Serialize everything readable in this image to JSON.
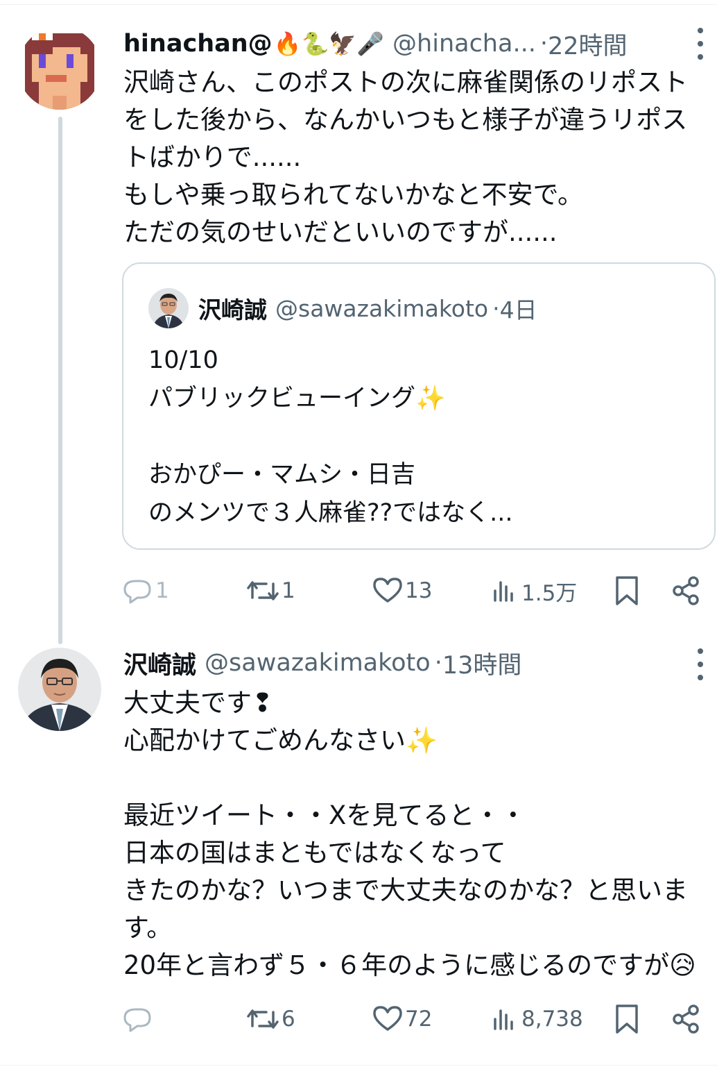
{
  "colors": {
    "text": "#0f1419",
    "muted": "#536471",
    "border": "#cfd9de"
  },
  "tweet1": {
    "name": "hinachan@",
    "emojis": "🔥🐍🦅🎤",
    "handle": "@hinacha...",
    "time": "22時間",
    "body": "沢崎さん、このポストの次に麻雀関係のリポスト\nをした後から、なんかいつもと様子が違うリポス\nトばかりで......\nもしや乗っ取られてないかなと不安で。\nただの気のせいだといいのですが......",
    "quote": {
      "name": "沢崎誠",
      "handle": "@sawazakimakoto",
      "time": "4日",
      "body": "10/10\nパブリックビューイング✨\n\nおかぴー・マムシ・日吉\nのメンツで３人麻雀??ではなく..."
    },
    "actions": {
      "reply_icon": "reply-icon",
      "reply": "1",
      "repost": "1",
      "like": "13",
      "views": "1.5万"
    }
  },
  "tweet2": {
    "name": "沢崎誠",
    "handle": "@sawazakimakoto",
    "time": "13時間",
    "body": "大丈夫です❢\n心配かけてごめんなさい✨\n\n最近ツイート・・Xを見てると・・\n日本の国はまともではなくなって\nきたのかな？いつまで大丈夫なのかな？と思いま\nす。\n20年と言わず５・６年のように感じるのですが😥",
    "actions": {
      "reply": "",
      "repost": "6",
      "like": "72",
      "views": "8,738"
    }
  },
  "separator": " · "
}
